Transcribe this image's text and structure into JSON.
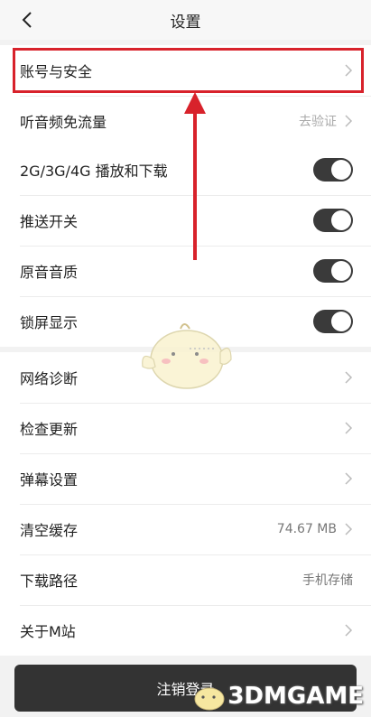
{
  "header": {
    "title": "设置",
    "back_icon": "back-chevron-icon"
  },
  "account_section": [
    {
      "label": "账号与安全",
      "value": "",
      "control": "chevron"
    },
    {
      "label": "听音频免流量",
      "value": "去验证",
      "control": "chevron"
    }
  ],
  "toggle_section": [
    {
      "label": "2G/3G/4G 播放和下载",
      "state": "on"
    },
    {
      "label": "推送开关",
      "state": "on"
    },
    {
      "label": "原音音质",
      "state": "on"
    },
    {
      "label": "锁屏显示",
      "state": "on"
    }
  ],
  "misc_section": [
    {
      "label": "网络诊断",
      "value": "",
      "control": "chevron"
    },
    {
      "label": "检查更新",
      "value": "",
      "control": "chevron"
    },
    {
      "label": "弹幕设置",
      "value": "",
      "control": "chevron"
    },
    {
      "label": "清空缓存",
      "value": "74.67 MB",
      "control": "chevron"
    },
    {
      "label": "下载路径",
      "value": "手机存储",
      "control": "none"
    },
    {
      "label": "关于M站",
      "value": "",
      "control": "chevron"
    }
  ],
  "footer": {
    "logout_label": "注销登录"
  },
  "watermark": {
    "text": "3DMGAME"
  },
  "colors": {
    "highlight": "#d8222b",
    "toggle_on": "#3a3a3a",
    "logout_bg": "#333333"
  }
}
